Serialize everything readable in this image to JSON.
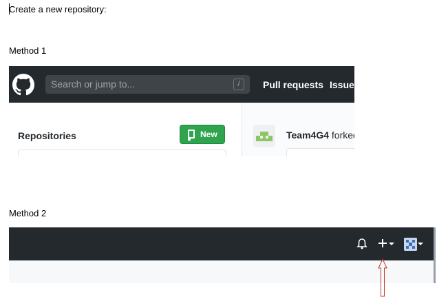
{
  "doc": {
    "intro": "Create a new repository:",
    "method1_label": "Method 1",
    "method2_label": "Method 2"
  },
  "method1": {
    "search_placeholder": "Search or jump to...",
    "search_shortcut": "/",
    "nav": {
      "pull_requests": "Pull requests",
      "issues": "Issues"
    },
    "repositories_title": "Repositories",
    "new_button_label": "New",
    "feed": {
      "user": "Team4G4",
      "action": "forked"
    },
    "colors": {
      "header": "#24292e",
      "new_button": "#2ea44f"
    },
    "icons": [
      "github-logo-icon",
      "repo-icon",
      "avatar-identicon"
    ]
  },
  "method2": {
    "icons": [
      "bell-icon",
      "plus-icon",
      "caret-down-icon",
      "avatar-icon"
    ],
    "annotation": "red-arrow-pointing-to-plus",
    "colors": {
      "header": "#24292e",
      "arrow": "#c0392b"
    }
  }
}
